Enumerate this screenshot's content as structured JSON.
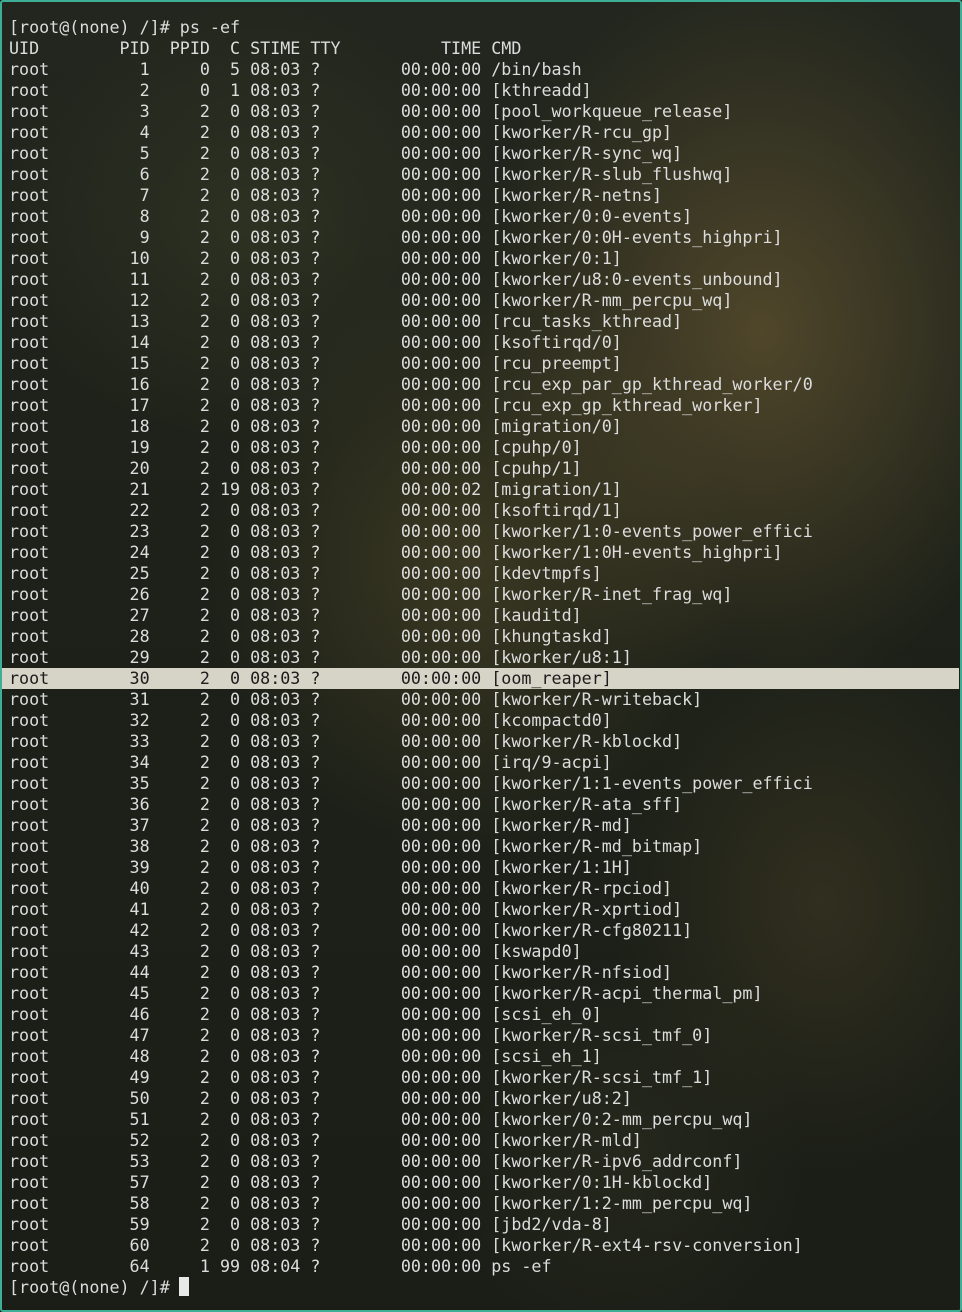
{
  "terminal": {
    "prompt": "[root@(none) /]#",
    "command_line": "[root@(none) /]# ps -ef",
    "header_line": "UID        PID  PPID  C STIME TTY          TIME CMD",
    "highlighted_row": 29,
    "rows": [
      "root         1     0  5 08:03 ?        00:00:00 /bin/bash",
      "root         2     0  1 08:03 ?        00:00:00 [kthreadd]",
      "root         3     2  0 08:03 ?        00:00:00 [pool_workqueue_release]",
      "root         4     2  0 08:03 ?        00:00:00 [kworker/R-rcu_gp]",
      "root         5     2  0 08:03 ?        00:00:00 [kworker/R-sync_wq]",
      "root         6     2  0 08:03 ?        00:00:00 [kworker/R-slub_flushwq]",
      "root         7     2  0 08:03 ?        00:00:00 [kworker/R-netns]",
      "root         8     2  0 08:03 ?        00:00:00 [kworker/0:0-events]",
      "root         9     2  0 08:03 ?        00:00:00 [kworker/0:0H-events_highpri]",
      "root        10     2  0 08:03 ?        00:00:00 [kworker/0:1]",
      "root        11     2  0 08:03 ?        00:00:00 [kworker/u8:0-events_unbound]",
      "root        12     2  0 08:03 ?        00:00:00 [kworker/R-mm_percpu_wq]",
      "root        13     2  0 08:03 ?        00:00:00 [rcu_tasks_kthread]",
      "root        14     2  0 08:03 ?        00:00:00 [ksoftirqd/0]",
      "root        15     2  0 08:03 ?        00:00:00 [rcu_preempt]",
      "root        16     2  0 08:03 ?        00:00:00 [rcu_exp_par_gp_kthread_worker/0",
      "root        17     2  0 08:03 ?        00:00:00 [rcu_exp_gp_kthread_worker]",
      "root        18     2  0 08:03 ?        00:00:00 [migration/0]",
      "root        19     2  0 08:03 ?        00:00:00 [cpuhp/0]",
      "root        20     2  0 08:03 ?        00:00:00 [cpuhp/1]",
      "root        21     2 19 08:03 ?        00:00:02 [migration/1]",
      "root        22     2  0 08:03 ?        00:00:00 [ksoftirqd/1]",
      "root        23     2  0 08:03 ?        00:00:00 [kworker/1:0-events_power_effici",
      "root        24     2  0 08:03 ?        00:00:00 [kworker/1:0H-events_highpri]",
      "root        25     2  0 08:03 ?        00:00:00 [kdevtmpfs]",
      "root        26     2  0 08:03 ?        00:00:00 [kworker/R-inet_frag_wq]",
      "root        27     2  0 08:03 ?        00:00:00 [kauditd]",
      "root        28     2  0 08:03 ?        00:00:00 [khungtaskd]",
      "root        29     2  0 08:03 ?        00:00:00 [kworker/u8:1]",
      "root        30     2  0 08:03 ?        00:00:00 [oom_reaper]",
      "root        31     2  0 08:03 ?        00:00:00 [kworker/R-writeback]",
      "root        32     2  0 08:03 ?        00:00:00 [kcompactd0]",
      "root        33     2  0 08:03 ?        00:00:00 [kworker/R-kblockd]",
      "root        34     2  0 08:03 ?        00:00:00 [irq/9-acpi]",
      "root        35     2  0 08:03 ?        00:00:00 [kworker/1:1-events_power_effici",
      "root        36     2  0 08:03 ?        00:00:00 [kworker/R-ata_sff]",
      "root        37     2  0 08:03 ?        00:00:00 [kworker/R-md]",
      "root        38     2  0 08:03 ?        00:00:00 [kworker/R-md_bitmap]",
      "root        39     2  0 08:03 ?        00:00:00 [kworker/1:1H]",
      "root        40     2  0 08:03 ?        00:00:00 [kworker/R-rpciod]",
      "root        41     2  0 08:03 ?        00:00:00 [kworker/R-xprtiod]",
      "root        42     2  0 08:03 ?        00:00:00 [kworker/R-cfg80211]",
      "root        43     2  0 08:03 ?        00:00:00 [kswapd0]",
      "root        44     2  0 08:03 ?        00:00:00 [kworker/R-nfsiod]",
      "root        45     2  0 08:03 ?        00:00:00 [kworker/R-acpi_thermal_pm]",
      "root        46     2  0 08:03 ?        00:00:00 [scsi_eh_0]",
      "root        47     2  0 08:03 ?        00:00:00 [kworker/R-scsi_tmf_0]",
      "root        48     2  0 08:03 ?        00:00:00 [scsi_eh_1]",
      "root        49     2  0 08:03 ?        00:00:00 [kworker/R-scsi_tmf_1]",
      "root        50     2  0 08:03 ?        00:00:00 [kworker/u8:2]",
      "root        51     2  0 08:03 ?        00:00:00 [kworker/0:2-mm_percpu_wq]",
      "root        52     2  0 08:03 ?        00:00:00 [kworker/R-mld]",
      "root        53     2  0 08:03 ?        00:00:00 [kworker/R-ipv6_addrconf]",
      "root        57     2  0 08:03 ?        00:00:00 [kworker/0:1H-kblockd]",
      "root        58     2  0 08:03 ?        00:00:00 [kworker/1:2-mm_percpu_wq]",
      "root        59     2  0 08:03 ?        00:00:00 [jbd2/vda-8]",
      "root        60     2  0 08:03 ?        00:00:00 [kworker/R-ext4-rsv-conversion]",
      "root        64     1 99 08:04 ?        00:00:00 ps -ef"
    ]
  },
  "colors": {
    "border": "#3fae97",
    "text": "#dcdcdc",
    "highlight_bg": "#d6d3c7",
    "highlight_text": "#1c1c1c"
  }
}
